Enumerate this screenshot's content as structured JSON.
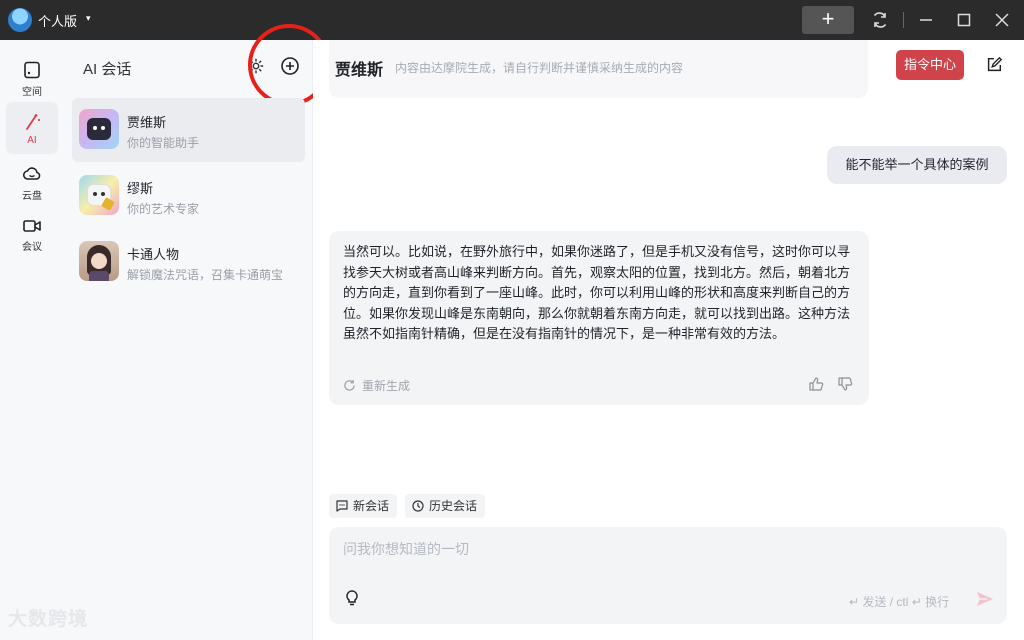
{
  "titlebar": {
    "user_label": "个人版",
    "caret": "▾",
    "plus_label": "+"
  },
  "rail": {
    "items": [
      {
        "label": "空间",
        "icon": "space-icon"
      },
      {
        "label": "AI",
        "icon": "ai-wand-icon"
      },
      {
        "label": "云盘",
        "icon": "cloud-icon"
      },
      {
        "label": "会议",
        "icon": "video-icon"
      }
    ]
  },
  "list": {
    "title": "AI 会话",
    "conversations": [
      {
        "name": "贾维斯",
        "desc": "你的智能助手"
      },
      {
        "name": "缪斯",
        "desc": "你的艺术专家"
      },
      {
        "name": "卡通人物",
        "desc": "解锁魔法咒语，召集卡通萌宝"
      }
    ]
  },
  "watermark": "大数跨境",
  "header": {
    "name": "贾维斯",
    "subtitle": "内容由达摩院生成，请自行判断并谨慎采纳生成的内容",
    "command_button": "指令中心"
  },
  "messages": {
    "user": "能不能举一个具体的案例",
    "bot": "当然可以。比如说，在野外旅行中，如果你迷路了，但是手机又没有信号，这时你可以寻找参天大树或者高山峰来判断方向。首先，观察太阳的位置，找到北方。然后，朝着北方的方向走，直到你看到了一座山峰。此时，你可以利用山峰的形状和高度来判断自己的方位。如果你发现山峰是东南朝向，那么你就朝着东南方向走，就可以找到出路。这种方法虽然不如指南针精确，但是在没有指南针的情况下，是一种非常有效的方法。",
    "regenerate": "重新生成"
  },
  "chips": {
    "new_chat": "新会话",
    "history": "历史会话"
  },
  "input": {
    "placeholder": "问我你想知道的一切",
    "hint": "↵ 发送 / ctl ↵ 换行"
  },
  "colors": {
    "accent_red": "#d1434b",
    "annotation_circle": "#e8201a"
  }
}
